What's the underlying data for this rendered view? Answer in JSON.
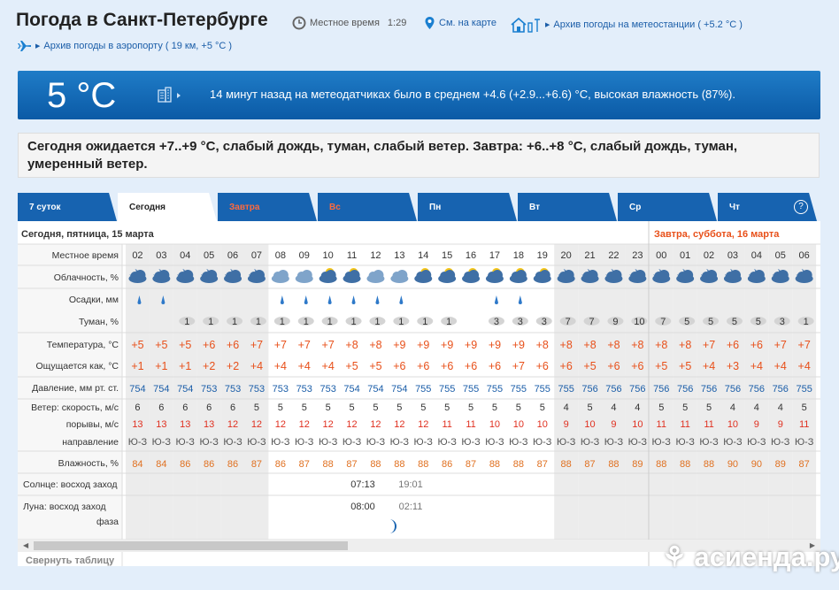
{
  "header": {
    "title": "Погода в Санкт-Петербурге",
    "local_time_label": "Местное время",
    "local_time": "1:29",
    "map_link": "См. на карте",
    "station_archive": "Архив погоды на метеостанции ( +5.2 °C )",
    "airport_archive": "Архив погоды в аэропорту ( 19 км, +5 °C )"
  },
  "banner": {
    "temp": "5 °C",
    "text": "14 минут назад на метеодатчиках было в среднем +4.6 (+2.9...+6.6) °C, высокая влажность (87%)."
  },
  "forecast": "Сегодня ожидается +7..+9 °C, слабый дождь, туман, слабый ветер. Завтра: +6..+8 °C, слабый дождь, туман, умеренный ветер.",
  "tabs": [
    {
      "label": "7 суток",
      "state": "normal"
    },
    {
      "label": "Сегодня",
      "state": "active"
    },
    {
      "label": "Завтра",
      "state": "weekend"
    },
    {
      "label": "Вс",
      "state": "weekend"
    },
    {
      "label": "Пн",
      "state": "normal"
    },
    {
      "label": "Вт",
      "state": "normal"
    },
    {
      "label": "Ср",
      "state": "normal"
    },
    {
      "label": "Чт",
      "state": "normal"
    }
  ],
  "help_label": "?",
  "table": {
    "day1_label": "Сегодня, пятница, 15 марта",
    "day2_label": "Завтра, суббота, 16 марта",
    "row_labels": {
      "time": "Местное время",
      "clouds": "Облачность, %",
      "precip": "Осадки, мм",
      "fog": "Туман, %",
      "temp": "Температура, °C",
      "feels": "Ощущается как, °C",
      "pressure": "Давление, мм рт. ст.",
      "wind": "Ветер: скорость, м/с",
      "gusts": "порывы, м/с",
      "dir": "направление",
      "humidity": "Влажность, %",
      "sun": "Солнце: восход заход",
      "moon": "Луна: восход заход",
      "phase": "фаза"
    },
    "hours": [
      "02",
      "03",
      "04",
      "05",
      "06",
      "07",
      "08",
      "09",
      "10",
      "11",
      "12",
      "13",
      "14",
      "15",
      "16",
      "17",
      "18",
      "19",
      "20",
      "21",
      "22",
      "23",
      "00",
      "01",
      "02",
      "03",
      "04",
      "05",
      "06"
    ],
    "sky": [
      "night",
      "night",
      "night",
      "night",
      "night",
      "night",
      "cloudy",
      "cloudy",
      "day",
      "day",
      "cloudy",
      "cloudy",
      "day",
      "day",
      "day",
      "day",
      "day",
      "day",
      "night",
      "night",
      "night",
      "night",
      "night",
      "night",
      "night",
      "night",
      "night",
      "night",
      "night"
    ],
    "rain": [
      true,
      true,
      false,
      false,
      false,
      false,
      true,
      true,
      true,
      true,
      true,
      true,
      false,
      false,
      false,
      true,
      true,
      false,
      false,
      false,
      false,
      false,
      false,
      false,
      false,
      false,
      false,
      false,
      false
    ],
    "fog": [
      "",
      "",
      "1",
      "1",
      "1",
      "1",
      "1",
      "1",
      "1",
      "1",
      "1",
      "1",
      "1",
      "1",
      "",
      "3",
      "3",
      "3",
      "7",
      "7",
      "9",
      "10",
      "7",
      "5",
      "5",
      "5",
      "5",
      "3",
      "1"
    ],
    "temp": [
      "+5",
      "+5",
      "+5",
      "+6",
      "+6",
      "+7",
      "+7",
      "+7",
      "+7",
      "+8",
      "+8",
      "+9",
      "+9",
      "+9",
      "+9",
      "+9",
      "+9",
      "+8",
      "+8",
      "+8",
      "+8",
      "+8",
      "+8",
      "+8",
      "+7",
      "+6",
      "+6",
      "+7",
      "+7"
    ],
    "feels": [
      "+1",
      "+1",
      "+1",
      "+2",
      "+2",
      "+4",
      "+4",
      "+4",
      "+4",
      "+5",
      "+5",
      "+6",
      "+6",
      "+6",
      "+6",
      "+6",
      "+7",
      "+6",
      "+6",
      "+5",
      "+6",
      "+6",
      "+5",
      "+5",
      "+4",
      "+3",
      "+4",
      "+4",
      "+4"
    ],
    "pressure": [
      "754",
      "754",
      "754",
      "753",
      "753",
      "753",
      "753",
      "753",
      "753",
      "754",
      "754",
      "754",
      "755",
      "755",
      "755",
      "755",
      "755",
      "755",
      "755",
      "756",
      "756",
      "756",
      "756",
      "756",
      "756",
      "756",
      "756",
      "756",
      "755"
    ],
    "wind": [
      "6",
      "6",
      "6",
      "6",
      "6",
      "5",
      "5",
      "5",
      "5",
      "5",
      "5",
      "5",
      "5",
      "5",
      "5",
      "5",
      "5",
      "5",
      "4",
      "5",
      "4",
      "4",
      "5",
      "5",
      "5",
      "4",
      "4",
      "4",
      "5"
    ],
    "gusts": [
      "13",
      "13",
      "13",
      "13",
      "12",
      "12",
      "12",
      "12",
      "12",
      "12",
      "12",
      "12",
      "12",
      "11",
      "11",
      "10",
      "10",
      "10",
      "9",
      "10",
      "9",
      "10",
      "11",
      "11",
      "11",
      "10",
      "9",
      "9",
      "11"
    ],
    "dir": [
      "Ю-З",
      "Ю-З",
      "Ю-З",
      "Ю-З",
      "Ю-З",
      "Ю-З",
      "Ю-З",
      "Ю-З",
      "Ю-З",
      "Ю-З",
      "Ю-З",
      "Ю-З",
      "Ю-З",
      "Ю-З",
      "Ю-З",
      "Ю-З",
      "Ю-З",
      "Ю-З",
      "Ю-З",
      "Ю-З",
      "Ю-З",
      "Ю-З",
      "Ю-З",
      "Ю-З",
      "Ю-З",
      "Ю-З",
      "Ю-З",
      "Ю-З",
      "Ю-З"
    ],
    "humidity": [
      "84",
      "84",
      "86",
      "86",
      "86",
      "87",
      "86",
      "87",
      "88",
      "87",
      "88",
      "88",
      "88",
      "86",
      "87",
      "88",
      "88",
      "87",
      "88",
      "87",
      "88",
      "89",
      "88",
      "88",
      "88",
      "90",
      "90",
      "89",
      "87"
    ],
    "sunrise": "07:13",
    "sunset": "19:01",
    "moonrise": "08:00",
    "moonset": "02:11"
  },
  "collapse_label": "Свернуть таблицу",
  "watermark": "асиенда.ру",
  "colors": {
    "accent": "#1763b0",
    "temp": "#e8501a",
    "pressure": "#1a5da8",
    "weekend": "#ff6a3d"
  }
}
